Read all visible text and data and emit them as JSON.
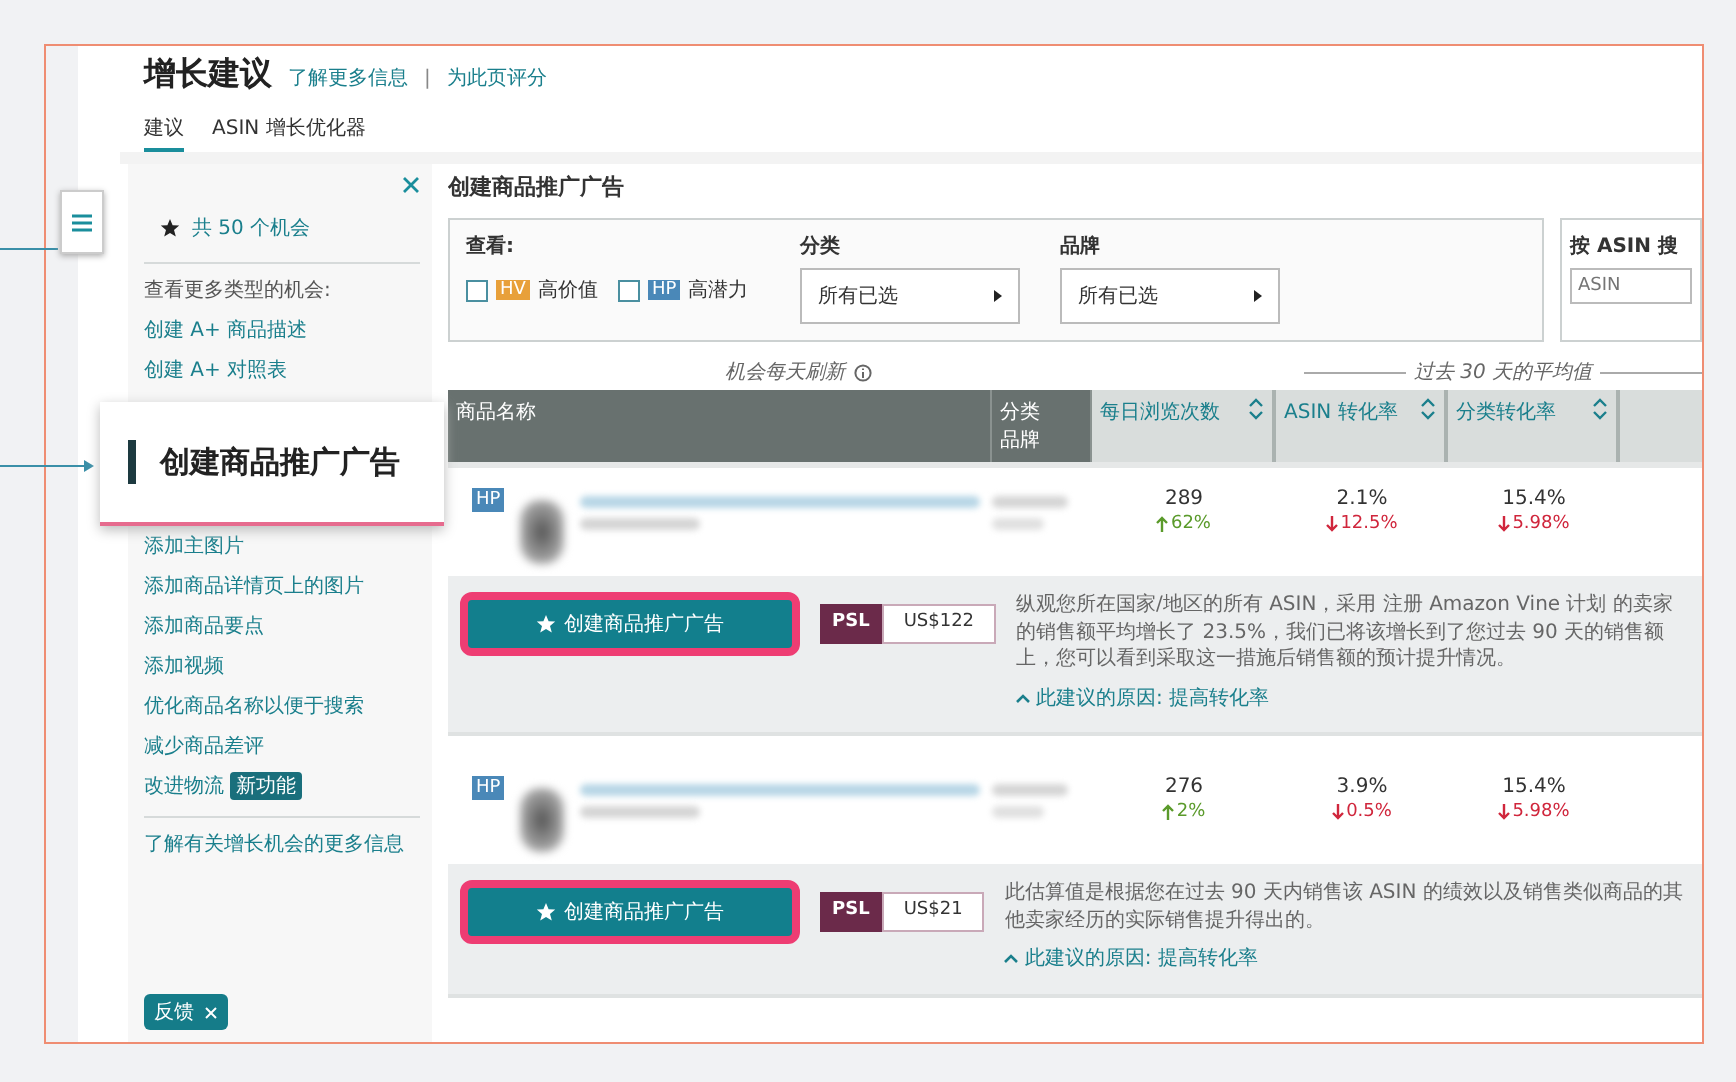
{
  "header": {
    "title": "增长建议",
    "links": [
      "了解更多信息",
      "为此页评分"
    ],
    "separator": "|"
  },
  "tabs": [
    {
      "label": "建议",
      "selected": true
    },
    {
      "label": "ASIN 增长优化器",
      "selected": false
    }
  ],
  "sidebar": {
    "summary": "共 50 个机会",
    "more_label": "查看更多类型的机会:",
    "items": [
      {
        "label": "创建 A+ 商品描述"
      },
      {
        "label": "创建 A+ 对照表"
      },
      {
        "label": "添加主图片"
      },
      {
        "label": "添加商品详情页上的图片"
      },
      {
        "label": "添加商品要点"
      },
      {
        "label": "添加视频"
      },
      {
        "label": "优化商品名称以便于搜索"
      },
      {
        "label": "减少商品差评"
      },
      {
        "label": "改进物流",
        "badge": "新功能"
      }
    ],
    "footer_link": "了解有关增长机会的更多信息",
    "feedback": "反馈"
  },
  "main": {
    "title": "创建商品推广广告",
    "filter": {
      "view_label": "查看:",
      "checkboxes": [
        {
          "badge": "HV",
          "label": "高价值",
          "checked": false,
          "color": "#e8a03a"
        },
        {
          "badge": "HP",
          "label": "高潜力",
          "checked": false,
          "color": "#4a88b8"
        }
      ],
      "dropdowns": [
        {
          "label": "分类",
          "value": "所有已选"
        },
        {
          "label": "品牌",
          "value": "所有已选"
        }
      ],
      "search": {
        "label": "按 ASIN 搜",
        "placeholder": "ASIN"
      }
    },
    "refresh_note": "机会每天刷新",
    "avg_note": "过去 30 天的平均值",
    "columns": [
      {
        "label": "商品名称",
        "kind": "plain"
      },
      {
        "label": "分类",
        "sub": "品牌",
        "kind": "plain"
      },
      {
        "label": "每日浏览次数",
        "kind": "sortable"
      },
      {
        "label": "ASIN 转化率",
        "kind": "sortable"
      },
      {
        "label": "分类转化率",
        "kind": "sortable"
      }
    ],
    "rows": [
      {
        "badge": "HP",
        "metrics": [
          {
            "value": "289",
            "change": "62%",
            "kind": "up"
          },
          {
            "value": "2.1%",
            "change": "12.5%",
            "kind": "down"
          },
          {
            "value": "15.4%",
            "change": "5.98%",
            "kind": "down"
          }
        ],
        "action": "创建商品推广广告",
        "tag": "PSL",
        "amount": "US$122",
        "description": "纵观您所在国家/地区的所有 ASIN，采用 注册 Amazon Vine 计划 的卖家的销售额平均增长了 23.5%，我们已将该增长到了您过去 90 天的销售额上，您可以看到采取这一措施后销售额的预计提升情况。",
        "reason_label": "此建议的原因:",
        "reason": "提高转化率"
      },
      {
        "badge": "HP",
        "metrics": [
          {
            "value": "276",
            "change": "2%",
            "kind": "up"
          },
          {
            "value": "3.9%",
            "change": "0.5%",
            "kind": "down"
          },
          {
            "value": "15.4%",
            "change": "5.98%",
            "kind": "down"
          }
        ],
        "action": "创建商品推广广告",
        "tag": "PSL",
        "amount": "US$21",
        "description": "此估算值是根据您在过去 90 天内销售该 ASIN 的绩效以及销售类似商品的其他卖家经历的实际销售提升得出的。",
        "reason_label": "此建议的原因:",
        "reason": "提高转化率"
      }
    ]
  },
  "callout": {
    "label": "创建商品推广广告"
  }
}
